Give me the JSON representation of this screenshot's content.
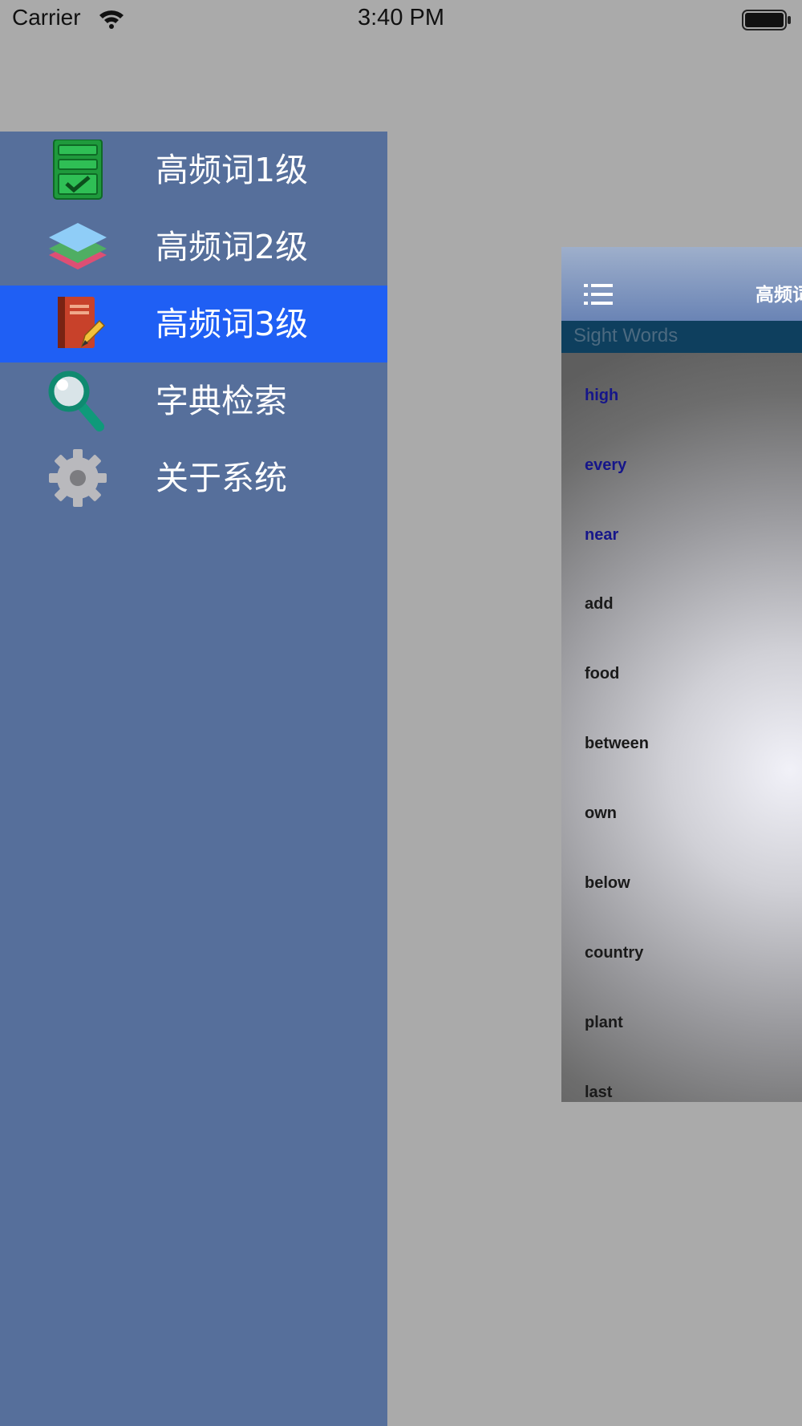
{
  "status_bar": {
    "carrier": "Carrier",
    "time": "3:40 PM"
  },
  "menu": {
    "items": [
      {
        "label": "高频词1级",
        "icon": "checklist-icon"
      },
      {
        "label": "高频词2级",
        "icon": "layers-icon"
      },
      {
        "label": "高频词3级",
        "icon": "book-pencil-icon",
        "selected": true
      },
      {
        "label": "字典检索",
        "icon": "search-icon"
      },
      {
        "label": "关于系统",
        "icon": "gear-icon"
      }
    ],
    "selected_color": "#1f5ff4",
    "background_color": "#566f9b"
  },
  "content": {
    "nav_title": "高频词",
    "section_header": "Sight Words",
    "words": [
      "high",
      "every",
      "near",
      "add",
      "food",
      "between",
      "own",
      "below",
      "country",
      "plant",
      "last"
    ]
  }
}
